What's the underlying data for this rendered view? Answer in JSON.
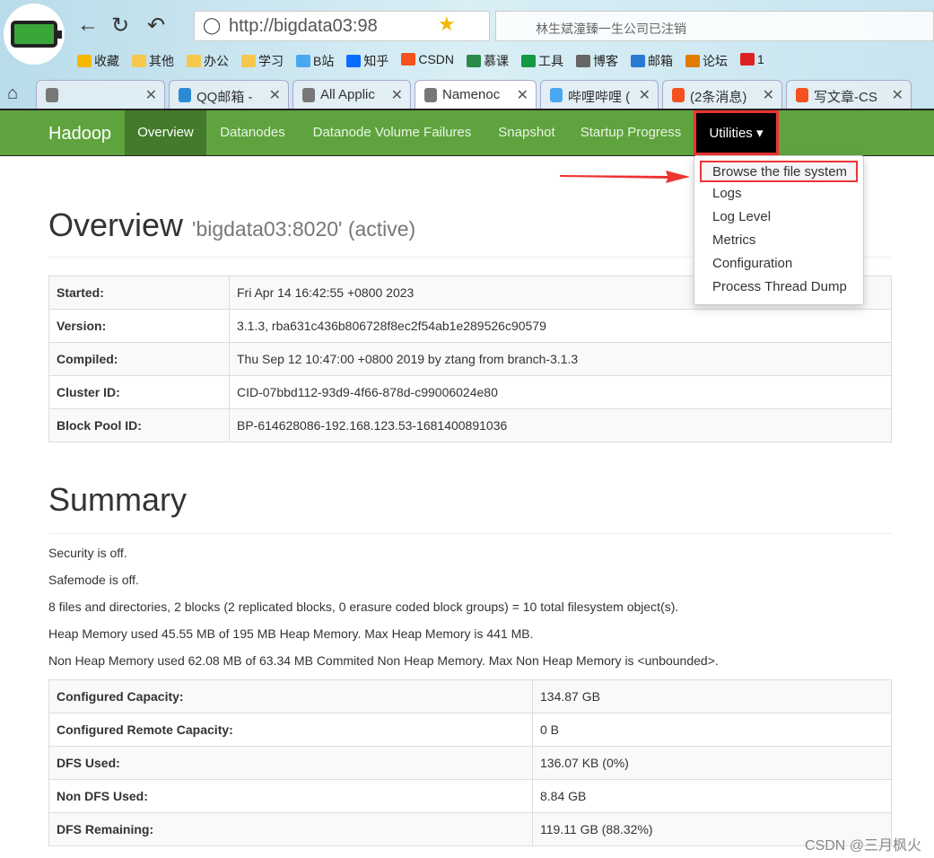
{
  "browser": {
    "url": "http://bigdata03:98",
    "search_placeholder": "林生斌潼臻一生公司已注销",
    "bookmarks": [
      "收藏",
      "其他",
      "办公",
      "学习",
      "B站",
      "知乎",
      "CSDN",
      "慕课",
      "工具",
      "博客",
      "邮箱",
      "论坛",
      "1"
    ],
    "tabs": [
      "",
      "QQ邮箱 -",
      "All Applic",
      "Namenoc",
      "哔哩哔哩 (",
      "(2条消息)",
      "写文章-CS"
    ]
  },
  "navbar": {
    "brand": "Hadoop",
    "items": [
      "Overview",
      "Datanodes",
      "Datanode Volume Failures",
      "Snapshot",
      "Startup Progress",
      "Utilities"
    ],
    "active": "Overview",
    "accent": "#5fa33e"
  },
  "utilities_menu": [
    "Browse the file system",
    "Logs",
    "Log Level",
    "Metrics",
    "Configuration",
    "Process Thread Dump"
  ],
  "overview": {
    "title": "Overview",
    "subtitle": "'bigdata03:8020' (active)",
    "rows": [
      [
        "Started:",
        "Fri Apr 14 16:42:55 +0800 2023"
      ],
      [
        "Version:",
        "3.1.3, rba631c436b806728f8ec2f54ab1e289526c90579"
      ],
      [
        "Compiled:",
        "Thu Sep 12 10:47:00 +0800 2019 by ztang from branch-3.1.3"
      ],
      [
        "Cluster ID:",
        "CID-07bbd112-93d9-4f66-878d-c99006024e80"
      ],
      [
        "Block Pool ID:",
        "BP-614628086-192.168.123.53-1681400891036"
      ]
    ]
  },
  "summary": {
    "title": "Summary",
    "lines": [
      "Security is off.",
      "Safemode is off.",
      "8 files and directories, 2 blocks (2 replicated blocks, 0 erasure coded block groups) = 10 total filesystem object(s).",
      "Heap Memory used 45.55 MB of 195 MB Heap Memory. Max Heap Memory is 441 MB.",
      "Non Heap Memory used 62.08 MB of 63.34 MB Commited Non Heap Memory. Max Non Heap Memory is <unbounded>."
    ],
    "rows": [
      [
        "Configured Capacity:",
        "134.87 GB"
      ],
      [
        "Configured Remote Capacity:",
        "0 B"
      ],
      [
        "DFS Used:",
        "136.07 KB (0%)"
      ],
      [
        "Non DFS Used:",
        "8.84 GB"
      ],
      [
        "DFS Remaining:",
        "119.11 GB (88.32%)"
      ]
    ]
  },
  "watermark": "CSDN @三月枫火"
}
